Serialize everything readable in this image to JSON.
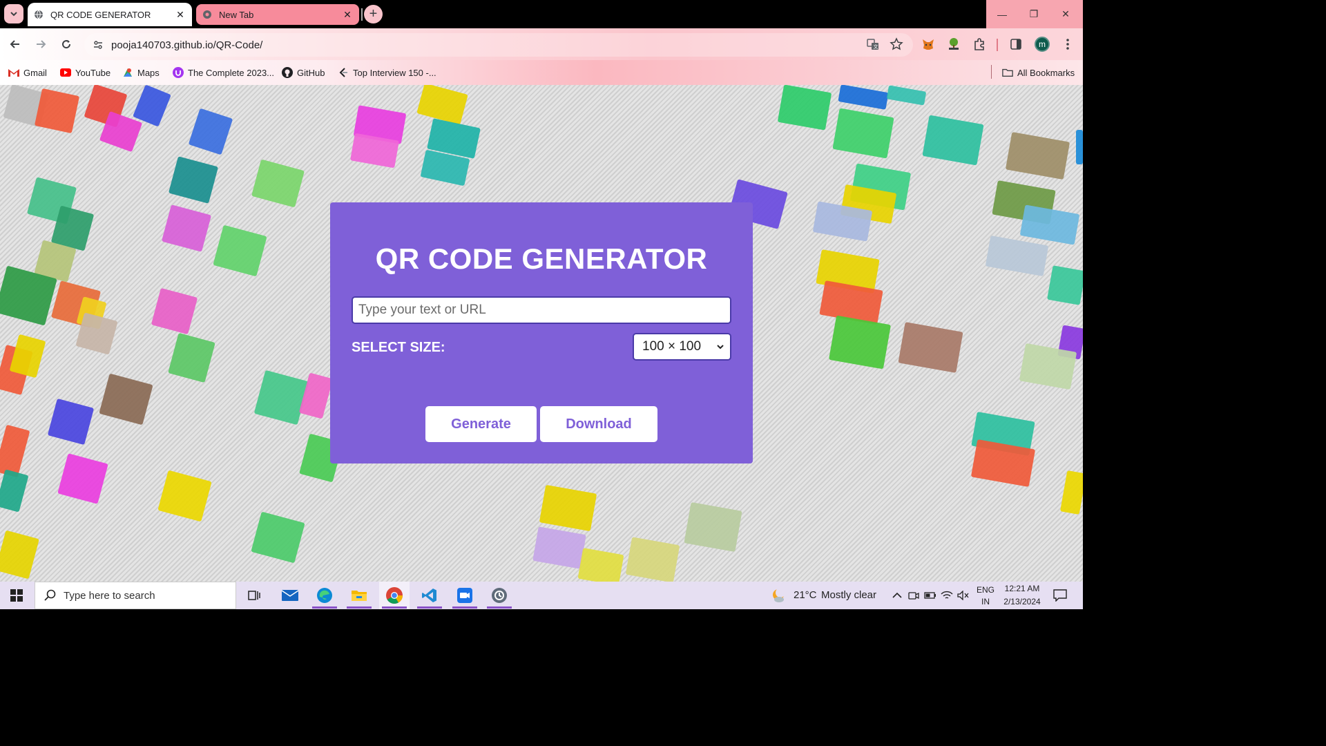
{
  "browser": {
    "tabs": [
      {
        "title": "QR CODE GENERATOR",
        "active": true
      },
      {
        "title": "New Tab",
        "active": false
      }
    ],
    "url": "pooja140703.github.io/QR-Code/",
    "profile_initial": "m",
    "bookmarks": [
      {
        "label": "Gmail",
        "icon": "gmail-icon"
      },
      {
        "label": "YouTube",
        "icon": "youtube-icon"
      },
      {
        "label": "Maps",
        "icon": "maps-icon"
      },
      {
        "label": "The Complete 2023...",
        "icon": "udemy-icon"
      },
      {
        "label": "GitHub",
        "icon": "github-icon"
      },
      {
        "label": "Top Interview 150 -...",
        "icon": "leetcode-icon"
      }
    ],
    "all_bookmarks_label": "All Bookmarks"
  },
  "app": {
    "title": "QR CODE GENERATOR",
    "input_placeholder": "Type your text or URL",
    "size_label": "SELECT SIZE:",
    "size_selected": "100 × 100",
    "generate_label": "Generate",
    "download_label": "Download",
    "card_color": "#7f60d8"
  },
  "taskbar": {
    "search_placeholder": "Type here to search",
    "weather_temp": "21°C",
    "weather_desc": "Mostly clear",
    "lang_top": "ENG",
    "lang_bottom": "IN",
    "time": "12:21 AM",
    "date": "2/13/2024"
  }
}
